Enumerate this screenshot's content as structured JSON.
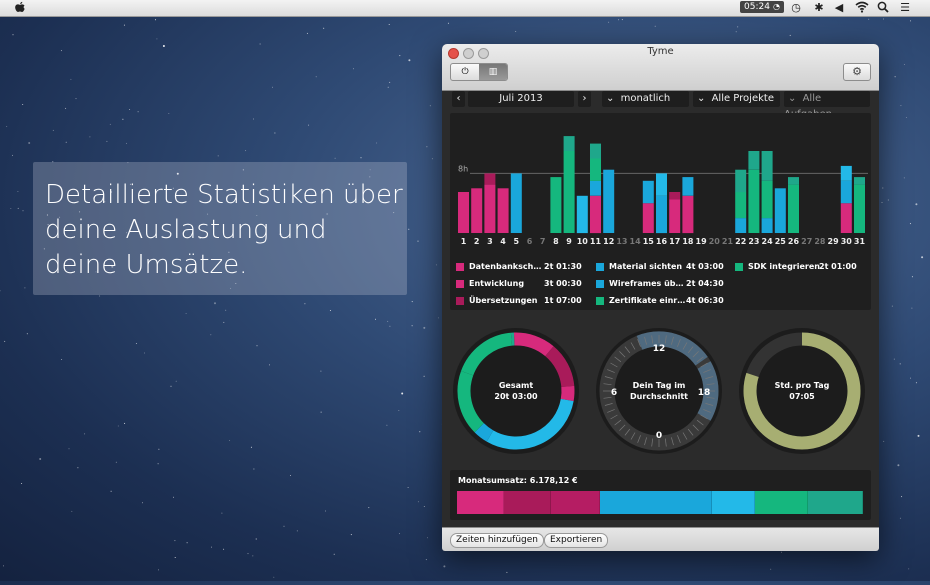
{
  "menubar": {
    "clock": "05:24",
    "icons": [
      "apple-icon",
      "clock-status-icon",
      "time-machine-icon",
      "bluetooth-icon",
      "volume-icon",
      "wifi-icon",
      "spotlight-icon",
      "notification-center-icon"
    ]
  },
  "promo": {
    "text": "Detaillierte Statistiken über deine Auslastung und deine Umsätze."
  },
  "window": {
    "title": "Tyme",
    "filters": {
      "month": "Juli 2013",
      "period": "monatlich",
      "projects": "Alle Projekte",
      "tasks": "Alle Aufgaben"
    },
    "buttons": {
      "add_times": "Zeiten hinzufügen",
      "export": "Exportieren"
    }
  },
  "colors": {
    "pink": "#d72a7c",
    "darkpink": "#a91b5a",
    "blue": "#1aa7db",
    "lightblue": "#23b9e8",
    "green": "#15b77e",
    "teal": "#1fa78b",
    "olive": "#a7ae72"
  },
  "chart_data": {
    "type": "bar",
    "reference_line_label": "8h",
    "categories": [
      "1",
      "2",
      "3",
      "4",
      "5",
      "6",
      "7",
      "8",
      "9",
      "10",
      "11",
      "12",
      "13",
      "14",
      "15",
      "16",
      "17",
      "18",
      "19",
      "20",
      "21",
      "22",
      "23",
      "24",
      "25",
      "26",
      "27",
      "28",
      "29",
      "30",
      "31"
    ],
    "weekend_days": [
      "6",
      "7",
      "13",
      "14",
      "20",
      "21",
      "27",
      "28"
    ],
    "series": [
      {
        "color": "pink",
        "values": [
          5.5,
          6,
          6.5,
          6,
          0,
          0,
          0,
          0,
          0,
          0,
          5,
          0,
          0,
          0,
          4,
          0,
          4.5,
          5,
          0,
          0,
          0,
          0,
          0,
          0,
          0,
          0,
          0,
          0,
          0,
          4,
          0
        ]
      },
      {
        "color": "darkpink",
        "values": [
          0,
          0,
          1.5,
          0,
          0,
          0,
          0,
          0,
          0,
          0,
          0,
          0,
          0,
          0,
          0,
          0,
          1,
          0,
          0,
          0,
          0,
          0,
          0,
          0,
          0,
          0,
          0,
          0,
          0,
          0,
          0
        ]
      },
      {
        "color": "blue",
        "values": [
          0,
          0,
          0,
          0,
          8,
          0,
          0,
          0,
          0,
          0,
          2,
          8.5,
          0,
          0,
          3,
          5,
          0,
          2.5,
          0,
          0,
          0,
          2,
          0,
          2,
          6,
          0,
          0,
          0,
          0,
          3,
          0
        ]
      },
      {
        "color": "lightblue",
        "values": [
          0,
          0,
          0,
          0,
          0,
          0,
          0,
          0,
          0,
          5,
          0,
          0,
          0,
          0,
          0,
          3,
          0,
          0,
          0,
          0,
          0,
          0,
          0,
          0,
          0,
          0,
          0,
          0,
          0,
          2,
          0
        ]
      },
      {
        "color": "green",
        "values": [
          0,
          0,
          0,
          0,
          0,
          0,
          0,
          7.5,
          11,
          0,
          3,
          0,
          0,
          0,
          0,
          0,
          0,
          0,
          0,
          0,
          0,
          3.5,
          8.5,
          5,
          0,
          6.5,
          0,
          0,
          0,
          0,
          6.5
        ]
      },
      {
        "color": "teal",
        "values": [
          0,
          0,
          0,
          0,
          0,
          0,
          0,
          0,
          2,
          0,
          2,
          0,
          0,
          0,
          0,
          0,
          0,
          0,
          0,
          0,
          0,
          3,
          2.5,
          4,
          0,
          1,
          0,
          0,
          0,
          0,
          1
        ]
      }
    ],
    "legend": [
      {
        "name": "Datenbanksch…",
        "value": "2t 01:30",
        "color": "pink"
      },
      {
        "name": "Material sichten",
        "value": "4t 03:00",
        "color": "blue"
      },
      {
        "name": "SDK integrieren",
        "value": "2t 01:00",
        "color": "green"
      },
      {
        "name": "Entwicklung",
        "value": "3t 00:30",
        "color": "pink"
      },
      {
        "name": "Wireframes üb…",
        "value": "2t 04:30",
        "color": "blue"
      },
      {
        "name": "Übersetzungen",
        "value": "1t 07:00",
        "color": "darkpink"
      },
      {
        "name": "Zertifikate einr…",
        "value": "4t 06:30",
        "color": "green"
      }
    ]
  },
  "donuts": {
    "total": {
      "label": "Gesamt",
      "value": "20t 03:00"
    },
    "day_avg": {
      "label_line1": "Dein Tag im",
      "label_line2": "Durchschnitt",
      "ticks": [
        "12",
        "18",
        "0",
        "6"
      ]
    },
    "per_day": {
      "label": "Std. pro Tag",
      "value": "07:05",
      "fill_fraction": 0.8
    }
  },
  "revenue": {
    "label": "Monatsumsatz: 6.178,12 €",
    "segments": [
      {
        "color": "pink",
        "fraction": 0.115
      },
      {
        "color": "darkpink",
        "fraction": 0.115
      },
      {
        "color": "pink2",
        "fraction": 0.12
      },
      {
        "color": "blue",
        "fraction": 0.28
      },
      {
        "color": "lightblue",
        "fraction": 0.105
      },
      {
        "color": "green",
        "fraction": 0.13
      },
      {
        "color": "teal",
        "fraction": 0.135
      }
    ]
  }
}
